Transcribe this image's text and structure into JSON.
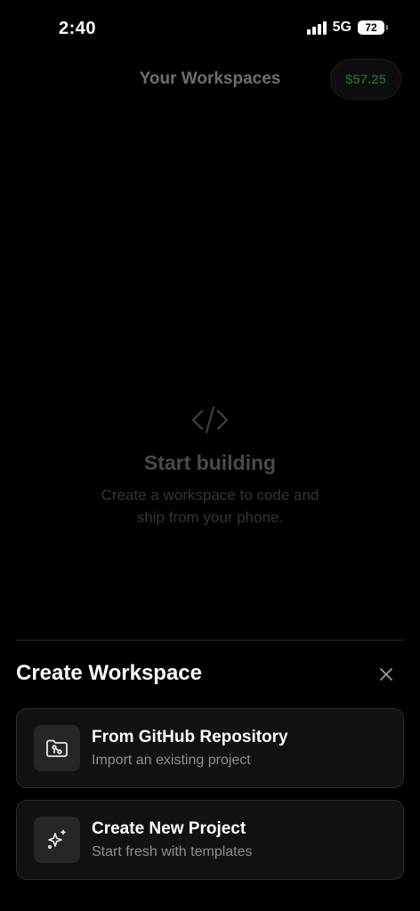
{
  "status_bar": {
    "time": "2:40",
    "network": "5G",
    "battery": "72"
  },
  "header": {
    "title": "Your Workspaces",
    "balance": "$57.25",
    "balance_color": "#1f5c2a"
  },
  "empty_state": {
    "icon": "code-icon",
    "title": "Start building",
    "description": "Create a workspace to code and ship from your phone."
  },
  "sheet": {
    "title": "Create Workspace",
    "close_icon": "close-icon",
    "options": [
      {
        "icon": "folder-git-icon",
        "title": "From GitHub Repository",
        "subtitle": "Import an existing project"
      },
      {
        "icon": "sparkles-icon",
        "title": "Create New Project",
        "subtitle": "Start fresh with templates"
      }
    ]
  }
}
